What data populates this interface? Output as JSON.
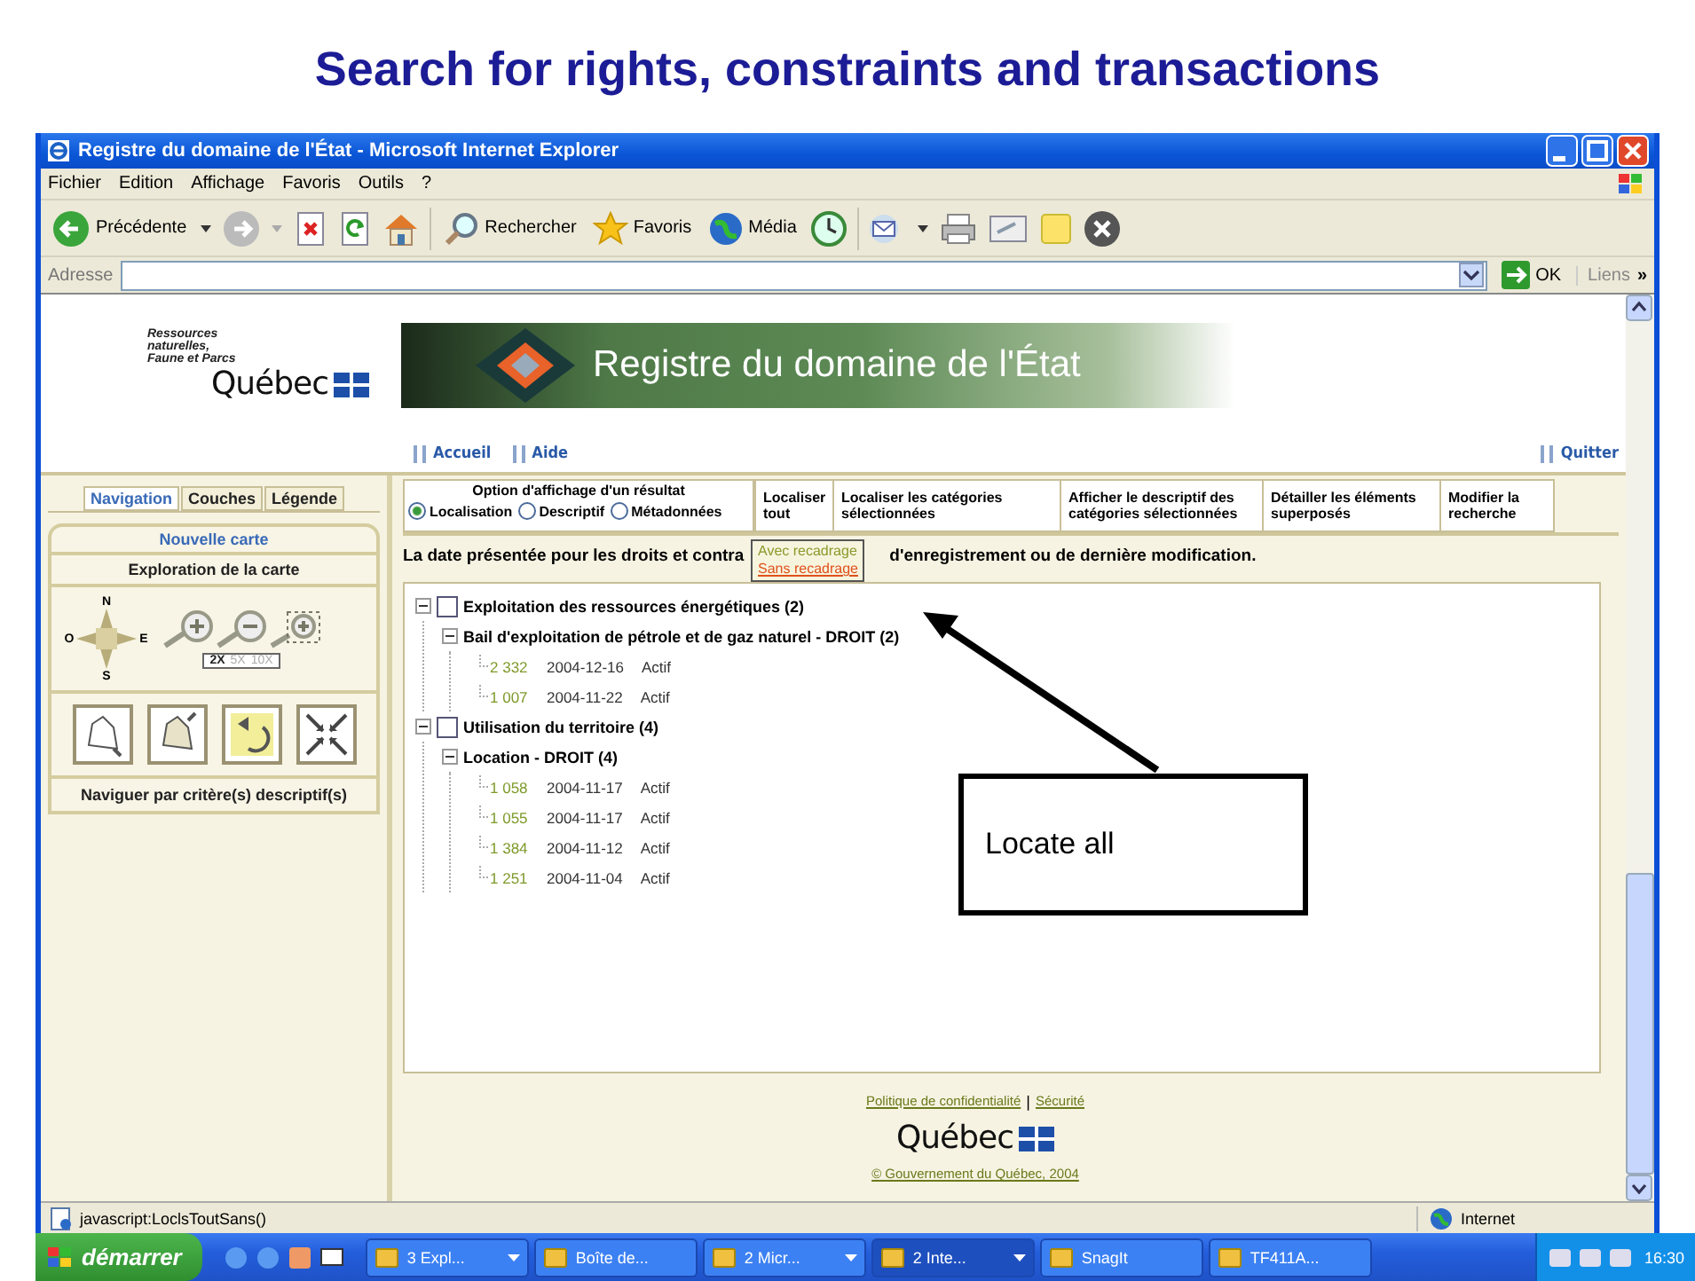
{
  "slide_title": "Search for rights, constraints and transactions",
  "browser": {
    "title": "Registre du domaine de l'État - Microsoft Internet Explorer",
    "menu": [
      "Fichier",
      "Edition",
      "Affichage",
      "Favoris",
      "Outils",
      "?"
    ],
    "toolbar_labels": [
      "Précédente",
      "Rechercher",
      "Favoris",
      "Média"
    ],
    "address": {
      "label": "Adresse",
      "go": "OK",
      "links": "Liens",
      "more": "»"
    },
    "status_bar": {
      "text": "javascript:LoclsToutSans()",
      "zone": "Internet"
    }
  },
  "page": {
    "agency": "Ressources naturelles, Faune et Parcs",
    "logo": "Québec",
    "banner_title": "Registre du domaine de l'État",
    "nav_links": [
      "Accueil",
      "Aide"
    ],
    "quit": "Quitter",
    "left_panel": {
      "tabs": [
        {
          "label": "Navigation",
          "selected": true
        },
        {
          "label": "Couches",
          "selected": false
        },
        {
          "label": "Légende",
          "selected": false
        }
      ],
      "new_map": "Nouvelle carte",
      "section": "Exploration de la carte",
      "compass": [
        "N",
        "O",
        "E",
        "S"
      ],
      "zoom_levels": [
        {
          "label": "2X",
          "selected": true
        },
        {
          "label": "5X",
          "selected": false
        },
        {
          "label": "10X",
          "selected": false
        }
      ],
      "criteria": "Naviguer par critère(s) descriptif(s)"
    },
    "options": {
      "title": "Option d'affichage d'un résultat",
      "radios": [
        {
          "label": "Localisation",
          "selected": true
        },
        {
          "label": "Descriptif",
          "selected": false
        },
        {
          "label": "Métadonnées",
          "selected": false
        }
      ]
    },
    "actions": [
      {
        "label": "Localiser tout",
        "open": true
      },
      {
        "label": "Localiser les catégories sélectionnées",
        "open": false
      },
      {
        "label": "Afficher le descriptif des catégories sélectionnées",
        "open": false
      },
      {
        "label": "Détailler les éléments superposés",
        "open": false
      },
      {
        "label": "Modifier la recherche",
        "open": false
      }
    ],
    "dropdown": [
      {
        "label": "Avec recadrage",
        "selected": false
      },
      {
        "label": "Sans recadrage",
        "selected": true
      }
    ],
    "notice_start": "La date présentée pour les droits et contra",
    "notice_end": "d'enregistrement ou de dernière modification.",
    "tree": [
      {
        "kind": "category",
        "label": "Exploitation des ressources énergétiques (2)",
        "checked": false,
        "expanded": true,
        "children": [
          {
            "kind": "type",
            "label": "Bail d'exploitation de pétrole et de gaz naturel - DROIT (2)",
            "expanded": true,
            "children": [
              {
                "kind": "record",
                "number": "2 332",
                "date": "2004-12-16",
                "status": "Actif"
              },
              {
                "kind": "record",
                "number": "1 007",
                "date": "2004-11-22",
                "status": "Actif"
              }
            ]
          }
        ]
      },
      {
        "kind": "category",
        "label": "Utilisation du territoire (4)",
        "checked": false,
        "expanded": true,
        "children": [
          {
            "kind": "type",
            "label": "Location - DROIT (4)",
            "expanded": true,
            "children": [
              {
                "kind": "record",
                "number": "1 058",
                "date": "2004-11-17",
                "status": "Actif"
              },
              {
                "kind": "record",
                "number": "1 055",
                "date": "2004-11-17",
                "status": "Actif"
              },
              {
                "kind": "record",
                "number": "1 384",
                "date": "2004-11-12",
                "status": "Actif"
              },
              {
                "kind": "record",
                "number": "1 251",
                "date": "2004-11-04",
                "status": "Actif"
              }
            ]
          }
        ]
      }
    ],
    "footer": {
      "links": [
        "Politique de confidentialité",
        "Sécurité"
      ],
      "separator": "|",
      "logo": "Québec",
      "copyright": "© Gouvernement du Québec, 2004"
    }
  },
  "taskbar": {
    "start": "démarrer",
    "tasks": [
      {
        "label": "3 Expl...",
        "kind": "group",
        "selected": false
      },
      {
        "label": "Boîte de...",
        "kind": "single",
        "selected": false
      },
      {
        "label": "2 Micr...",
        "kind": "group",
        "selected": false
      },
      {
        "label": "2 Inte...",
        "kind": "group",
        "selected": true
      },
      {
        "label": "SnagIt",
        "kind": "single",
        "selected": false
      },
      {
        "label": "TF411A...",
        "kind": "single",
        "selected": false
      }
    ],
    "clock": "16:30"
  },
  "callout": "Locate all"
}
